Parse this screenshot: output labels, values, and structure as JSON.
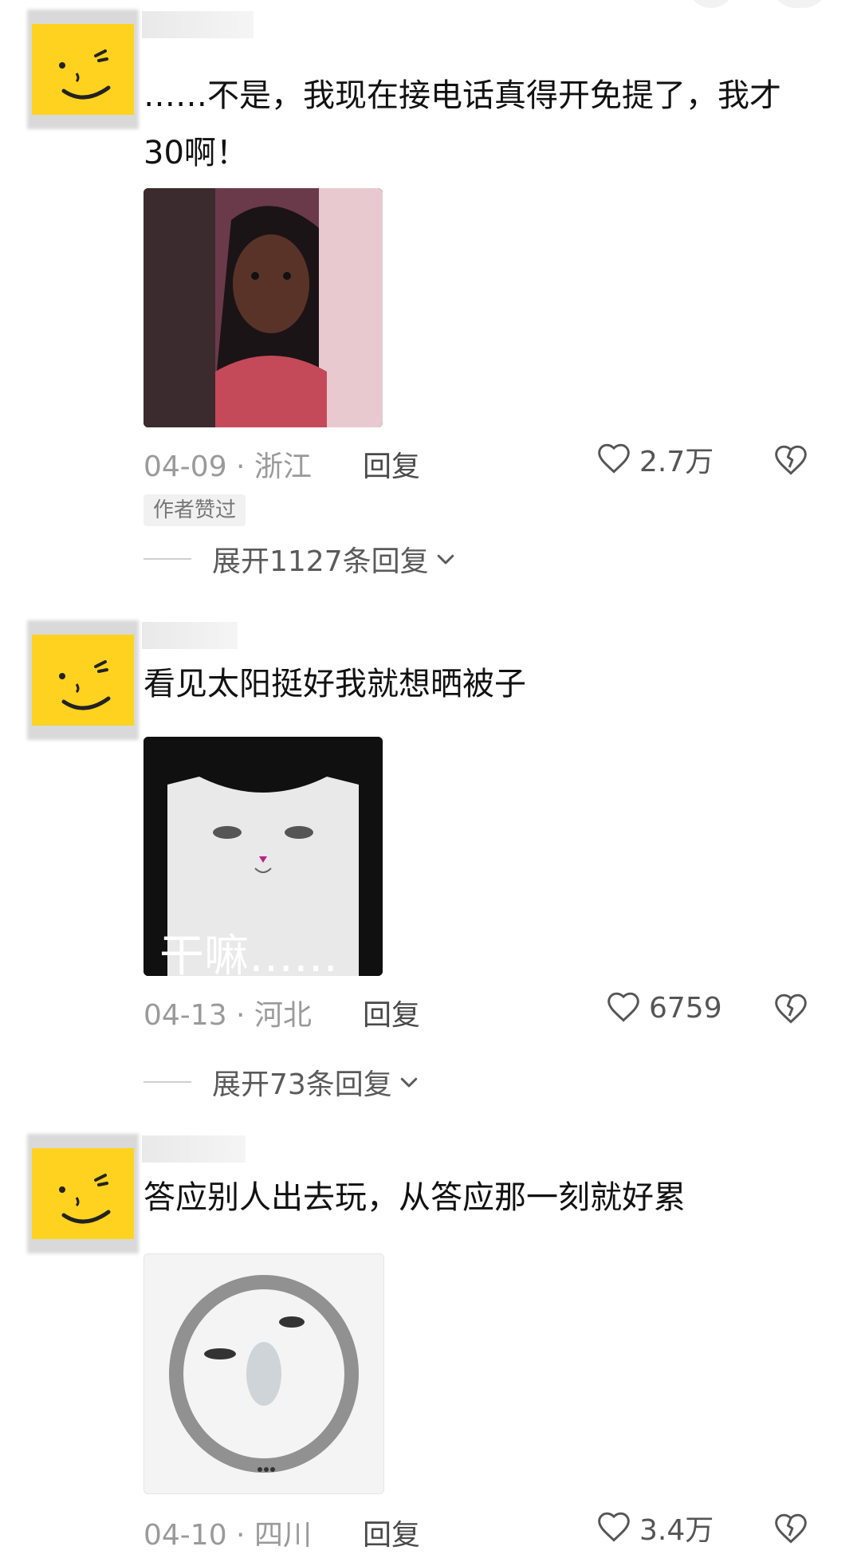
{
  "comments": [
    {
      "text": "……不是，我现在接电话真得开免提了，我才30啊！",
      "date_location": "04-09 · 浙江",
      "reply_label": "回复",
      "likes": "2.7万",
      "badge": "作者赞过",
      "expand_label": "展开1127条回复"
    },
    {
      "text": "看见太阳挺好我就想晒被子",
      "date_location": "04-13 · 河北",
      "reply_label": "回复",
      "likes": "6759",
      "expand_label": "展开73条回复",
      "media_caption": "干嘛……"
    },
    {
      "text": "答应别人出去玩，从答应那一刻就好累",
      "date_location": "04-10 · 四川",
      "reply_label": "回复",
      "likes": "3.4万"
    }
  ],
  "colors": {
    "avatar": "#ffd21f",
    "meta": "#9a9a9a",
    "text": "#111111"
  },
  "icons": [
    "heart-outline-icon",
    "broken-heart-icon",
    "chevron-down-icon"
  ]
}
